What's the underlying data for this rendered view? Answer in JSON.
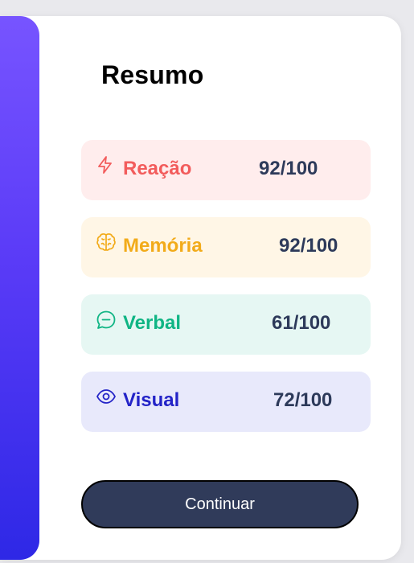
{
  "summary": {
    "title": "Resumo",
    "rows": [
      {
        "label": "Reação",
        "score": "92/100",
        "icon": "lightning-icon",
        "color": "#f25c5c",
        "background": "#ffeded"
      },
      {
        "label": "Memória",
        "score": "92/100",
        "icon": "brain-icon",
        "color": "#f2ab1a",
        "background": "#fff6e6"
      },
      {
        "label": "Verbal",
        "score": "61/100",
        "icon": "chat-bubble-icon",
        "color": "#10b584",
        "background": "#e6f7f3"
      },
      {
        "label": "Visual",
        "score": "72/100",
        "icon": "eye-icon",
        "color": "#2323c7",
        "background": "#e8e9fb"
      }
    ]
  },
  "actions": {
    "continue_label": "Continuar"
  },
  "colors": {
    "accent_gradient_top": "#7754ff",
    "accent_gradient_bottom": "#2e28e6",
    "score_text": "#2d3a5a",
    "button_bg": "#303b5a"
  }
}
